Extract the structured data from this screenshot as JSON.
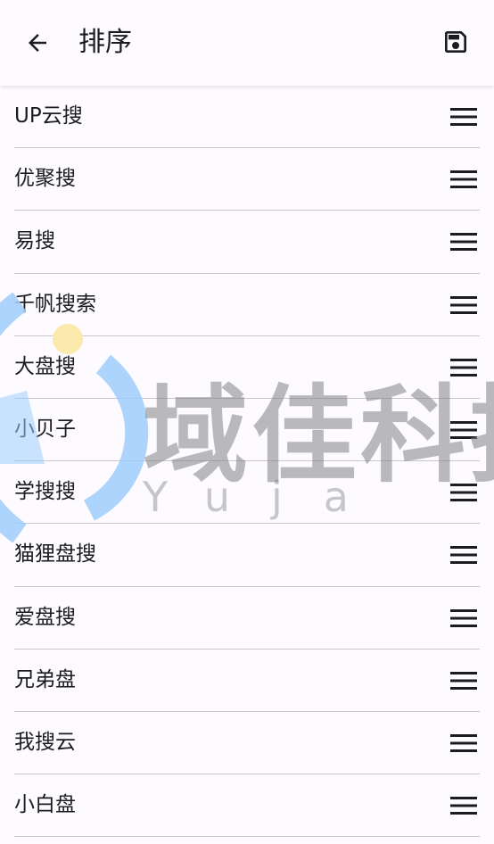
{
  "header": {
    "title": "排序",
    "back_icon": "arrow-left-icon",
    "save_icon": "save-icon"
  },
  "items": [
    {
      "label": "UP云搜"
    },
    {
      "label": "优聚搜"
    },
    {
      "label": "易搜"
    },
    {
      "label": "千帆搜索"
    },
    {
      "label": "大盘搜"
    },
    {
      "label": "小贝子"
    },
    {
      "label": "学搜搜"
    },
    {
      "label": "猫狸盘搜"
    },
    {
      "label": "爱盘搜"
    },
    {
      "label": "兄弟盘"
    },
    {
      "label": "我搜云"
    },
    {
      "label": "小白盘"
    }
  ],
  "watermark": {
    "text": "域佳科技",
    "subtext": "Yuja"
  },
  "colors": {
    "background": "#fdfbff",
    "text": "#1c1b1f",
    "divider": "#cac4d0",
    "watermark_blue": "#9fcdfb",
    "watermark_yellow": "#fce9a8"
  }
}
